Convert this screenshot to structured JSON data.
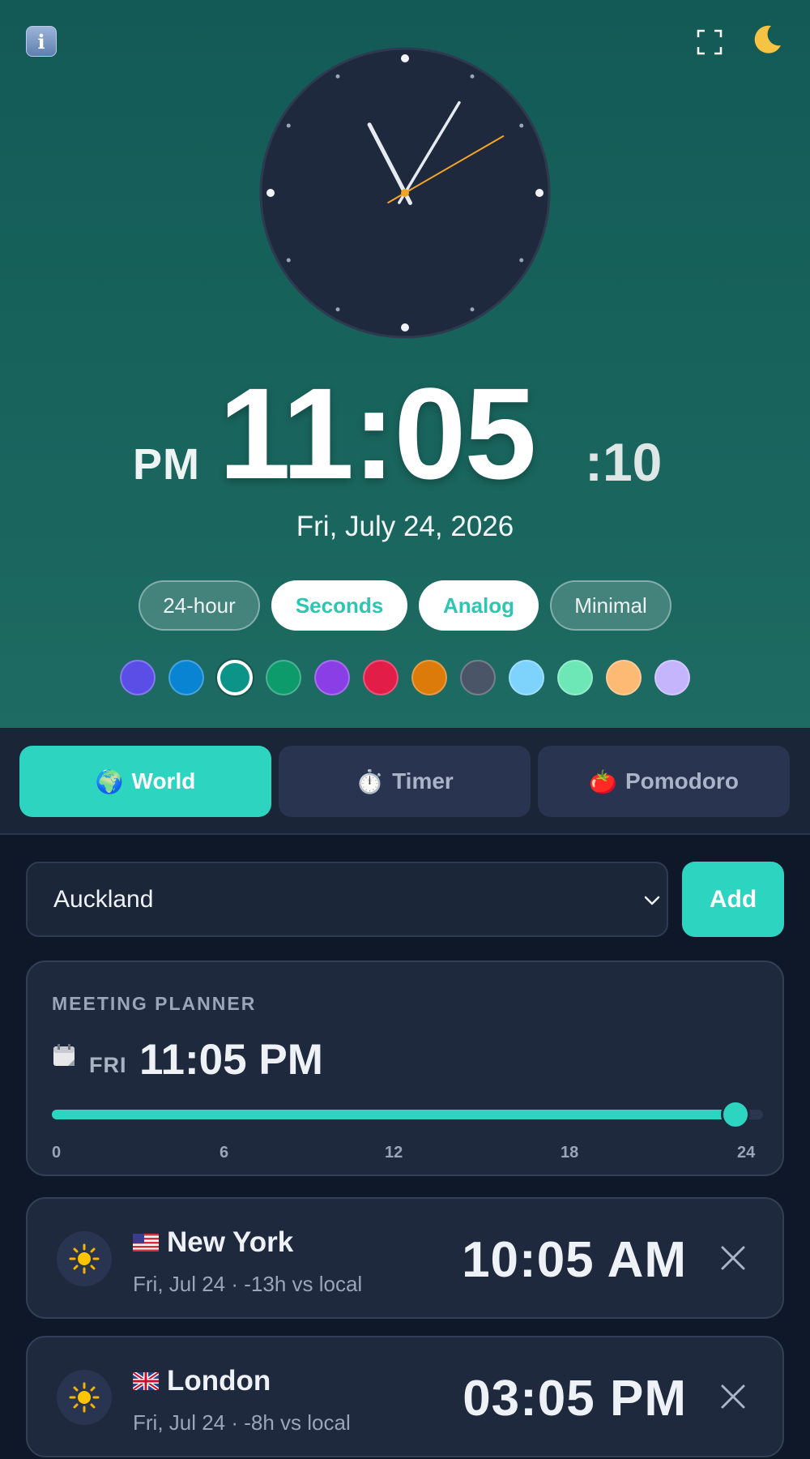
{
  "header": {
    "info_icon": "info-icon",
    "fullscreen_icon": "fullscreen-icon",
    "theme_icon": "moon-icon"
  },
  "clock": {
    "ampm": "PM",
    "time": "11:05",
    "seconds": ":10",
    "date": "Fri, July 24, 2026",
    "analog_hour": 11,
    "analog_minute": 5,
    "analog_second": 10
  },
  "toggles": [
    {
      "label": "24-hour",
      "active": false
    },
    {
      "label": "Seconds",
      "active": true
    },
    {
      "label": "Analog",
      "active": true
    },
    {
      "label": "Minimal",
      "active": false
    }
  ],
  "theme_colors": [
    "#5b4ee6",
    "#0884d2",
    "#0d9488",
    "#0e9b6b",
    "#8a3fe6",
    "#e11d48",
    "#dd7b0a",
    "#4a5568",
    "#7dd3fc",
    "#6ee7b7",
    "#fdba74",
    "#c4b5fd"
  ],
  "theme_selected_index": 2,
  "tabs": [
    {
      "icon": "🌍",
      "label": "World",
      "active": true
    },
    {
      "icon": "⏱️",
      "label": "Timer",
      "active": false
    },
    {
      "icon": "🍅",
      "label": "Pomodoro",
      "active": false
    }
  ],
  "add_city": {
    "selected": "Auckland",
    "button": "Add"
  },
  "planner": {
    "label": "MEETING PLANNER",
    "day": "FRI",
    "time": "11:05 PM",
    "hour_value": 23.08,
    "hour_max": 24,
    "ticks": [
      "0",
      "6",
      "12",
      "18",
      "24"
    ]
  },
  "cities": [
    {
      "name": "New York",
      "flag": "us-flag",
      "sub": "Fri, Jul 24 · -13h vs local",
      "time": "10:05 AM",
      "icon": "sun-icon"
    },
    {
      "name": "London",
      "flag": "uk-flag",
      "sub": "Fri, Jul 24 · -8h vs local",
      "time": "03:05 PM",
      "icon": "sun-icon"
    }
  ],
  "colors": {
    "accent": "#2dd4bf",
    "hero_bg": "#135a56",
    "page_bg": "#0f1829",
    "card_bg": "#1f293d"
  }
}
